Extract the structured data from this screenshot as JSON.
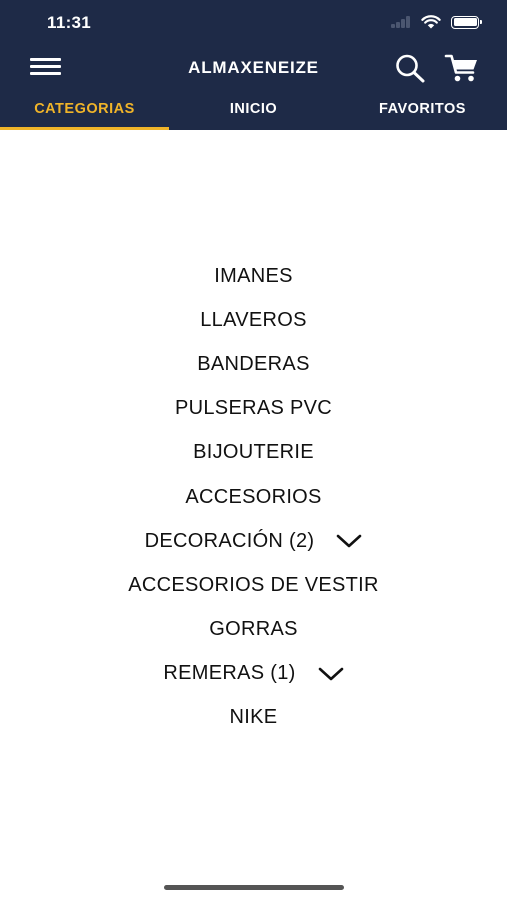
{
  "status_bar": {
    "time": "11:31"
  },
  "app_bar": {
    "title": "ALMAXENEIZE"
  },
  "tabs": [
    {
      "label": "CATEGORIAS",
      "active": true
    },
    {
      "label": "INICIO",
      "active": false
    },
    {
      "label": "FAVORITOS",
      "active": false
    }
  ],
  "categories": [
    {
      "label": "IMANES",
      "expandable": false
    },
    {
      "label": "LLAVEROS",
      "expandable": false
    },
    {
      "label": "BANDERAS",
      "expandable": false
    },
    {
      "label": "PULSERAS PVC",
      "expandable": false
    },
    {
      "label": "BIJOUTERIE",
      "expandable": false
    },
    {
      "label": "ACCESORIOS",
      "expandable": false
    },
    {
      "label": "DECORACIÓN (2)",
      "expandable": true
    },
    {
      "label": "ACCESORIOS DE VESTIR",
      "expandable": false
    },
    {
      "label": "GORRAS",
      "expandable": false
    },
    {
      "label": "REMERAS (1)",
      "expandable": true
    },
    {
      "label": "NIKE",
      "expandable": false
    }
  ],
  "icons": {
    "menu": "hamburger-menu-icon",
    "search": "search-icon",
    "cart": "shopping-cart-icon",
    "expand": "chevron-down-icon"
  },
  "colors": {
    "header_bg": "#1e2a47",
    "accent": "#f0b429",
    "text": "#111111"
  }
}
